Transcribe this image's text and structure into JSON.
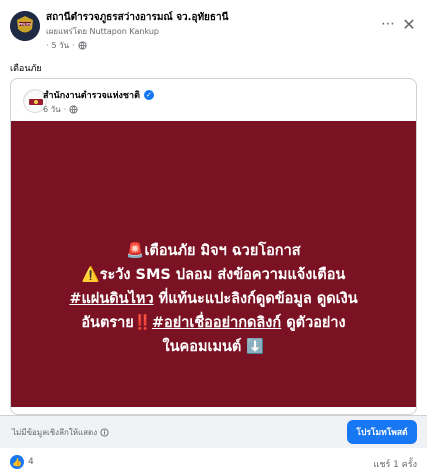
{
  "post": {
    "page_name": "สถานีตำรวจภูธรสว่างอารมณ์ จว.อุทัยธานี",
    "published_by": "เผยแพร่โดย Nuttapon Kankup",
    "time": "5 วัน",
    "caption": "เตือนภัย"
  },
  "shared": {
    "page_name": "สำนักงานตำรวจแห่งชาติ",
    "time": "6 วัน",
    "banner_lines": [
      "🚨เตือนภัย มิจฯ ฉวยโอกาส",
      "⚠️ระวัง SMS ปลอม ส่งข้อความแจ้งเตือน",
      "#แผ่นดินไหว",
      "ที่แท้นะแปะลิงก์ดูดข้อมูล ดูดเงิน",
      "อันตราย‼️",
      "#อย่าเชื่ออย่ากดลิงก์",
      "ดูตัวอย่าง",
      "ในคอมเมนต์ ⬇️"
    ]
  },
  "link_row": {
    "no_info": "ไม่มีข้อมูลเชิงลึกให้แสดง",
    "promote_label": "โปรโมทโพสต์"
  },
  "stats": {
    "reactions": "4",
    "shares": "แชร์ 1 ครั้ง"
  },
  "colors": {
    "banner_bg": "#7a1224",
    "accent": "#1877f2"
  }
}
